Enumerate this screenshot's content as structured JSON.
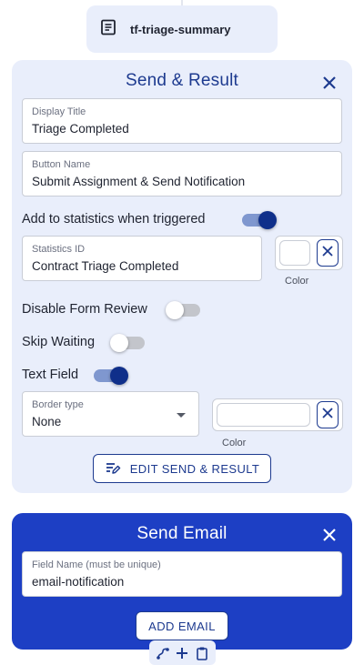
{
  "node": {
    "label": "tf-triage-summary",
    "icon": "document-icon"
  },
  "send_result": {
    "title": "Send & Result",
    "display_title": {
      "label": "Display Title",
      "value": "Triage Completed"
    },
    "button_name": {
      "label": "Button Name",
      "value": "Submit Assignment & Send Notification"
    },
    "add_statistics": {
      "label": "Add to statistics when triggered",
      "enabled": true
    },
    "statistics_id": {
      "label": "Statistics ID",
      "value": "Contract Triage Completed"
    },
    "statistics_color_caption": "Color",
    "disable_form_review": {
      "label": "Disable Form Review",
      "enabled": false
    },
    "skip_waiting": {
      "label": "Skip Waiting",
      "enabled": false
    },
    "text_field": {
      "label": "Text Field",
      "enabled": true
    },
    "border_type": {
      "label": "Border type",
      "value": "None"
    },
    "text_field_color_caption": "Color",
    "edit_button_label": "EDIT SEND & RESULT"
  },
  "send_email": {
    "title": "Send Email",
    "field_name": {
      "label": "Field Name (must be unique)",
      "value": "email-notification"
    },
    "add_button_label": "ADD EMAIL"
  },
  "colors": {
    "panel_bg": "#e9eefb",
    "accent": "#1d3a8f",
    "toggle_on": "#0f2f8a",
    "email_card_bg": "#1d3fc4"
  }
}
